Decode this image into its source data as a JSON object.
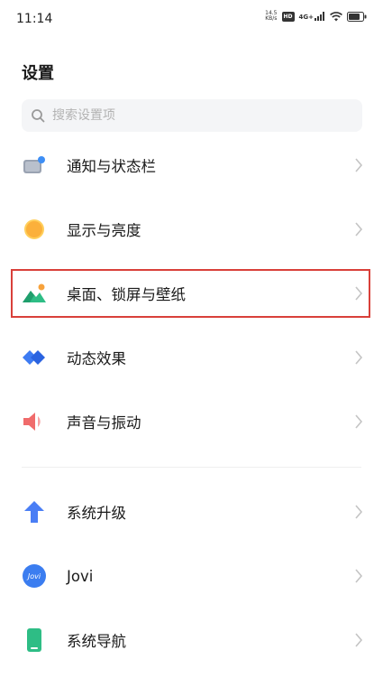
{
  "status_bar": {
    "time": "11:14",
    "net_speed_value": "14.5",
    "net_speed_unit": "KB/s",
    "hd_badge": "HD",
    "signal_label": "4G+"
  },
  "page": {
    "title": "设置"
  },
  "search": {
    "placeholder": "搜索设置项"
  },
  "items": [
    {
      "label": "通知与状态栏",
      "icon": "notification-icon"
    },
    {
      "label": "显示与亮度",
      "icon": "display-brightness-icon"
    },
    {
      "label": "桌面、锁屏与壁纸",
      "icon": "wallpaper-icon",
      "highlighted": true
    },
    {
      "label": "动态效果",
      "icon": "dynamic-effect-icon"
    },
    {
      "label": "声音与振动",
      "icon": "sound-icon"
    },
    {
      "label": "系统升级",
      "icon": "system-upgrade-icon"
    },
    {
      "label": "Jovi",
      "icon": "jovi-icon",
      "icon_text": "Jovi"
    },
    {
      "label": "系统导航",
      "icon": "system-navigation-icon"
    }
  ],
  "colors": {
    "highlight_border": "#d9403a",
    "chevron": "#c4c4c4"
  }
}
